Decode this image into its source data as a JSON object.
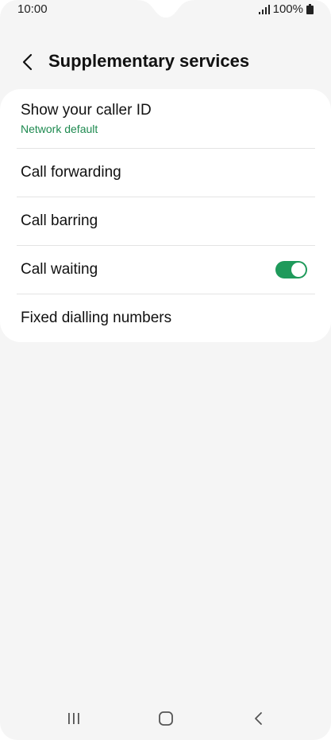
{
  "status_bar": {
    "time": "10:00",
    "battery": "100%",
    "signal_icon": "signal-icon",
    "battery_icon": "battery-icon"
  },
  "header": {
    "back_icon": "back-arrow-icon",
    "title": "Supplementary services"
  },
  "settings": {
    "items": [
      {
        "label": "Show your caller ID",
        "sublabel": "Network default"
      },
      {
        "label": "Call forwarding"
      },
      {
        "label": "Call barring"
      },
      {
        "label": "Call waiting",
        "toggle_on": true
      },
      {
        "label": "Fixed dialling numbers"
      }
    ]
  },
  "colors": {
    "accent": "#1f9a5b",
    "sublabel": "#1e8a50",
    "background": "#f5f5f5",
    "card": "#ffffff"
  },
  "nav_bar": {
    "recents_icon": "recents-icon",
    "home_icon": "home-icon",
    "back_icon": "back-icon"
  }
}
